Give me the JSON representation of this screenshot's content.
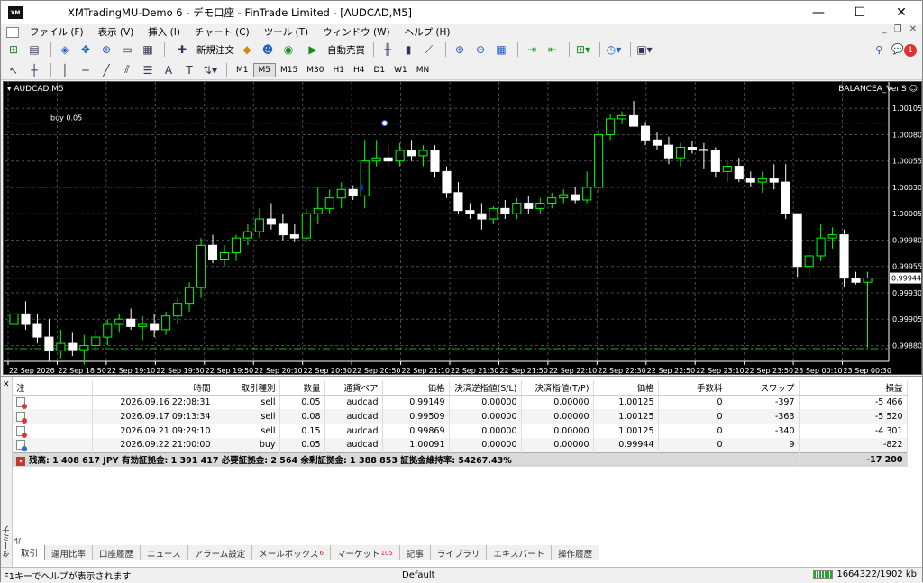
{
  "window": {
    "title": "XMTradingMU-Demo 6 - デモ口座 - FinTrade Limited - [AUDCAD,M5]",
    "app_logo": "XM"
  },
  "menu": [
    "ファイル (F)",
    "表示 (V)",
    "挿入 (I)",
    "チャート (C)",
    "ツール (T)",
    "ウィンドウ (W)",
    "ヘルプ (H)"
  ],
  "toolbar": {
    "new_order": "新規注文",
    "auto_trading": "自動売買",
    "notification_count": "1",
    "timeframes": [
      "M1",
      "M5",
      "M15",
      "M30",
      "H1",
      "H4",
      "D1",
      "W1",
      "MN"
    ],
    "active_timeframe": "M5"
  },
  "chart": {
    "symbol_label": "AUDCAD,M5",
    "ea_label": "BALANCEA_Ver.S",
    "buy_label": "buy 0.05",
    "current_price": "0.99944",
    "colors": {
      "background": "#000000",
      "up": "#00ff00",
      "down": "#ffffff",
      "grid": "#4a4a4a",
      "trade_line": "#1a2cff"
    },
    "price_ticks": [
      "1.00105",
      "1.00080",
      "1.00055",
      "1.00030",
      "1.00005",
      "0.99980",
      "0.99955",
      "0.99930",
      "0.99905",
      "0.99880"
    ],
    "time_ticks": [
      "22 Sep 2026",
      "22 Sep 18:50",
      "22 Sep 19:10",
      "22 Sep 19:30",
      "22 Sep 19:50",
      "22 Sep 20:10",
      "22 Sep 20:30",
      "22 Sep 20:50",
      "22 Sep 21:10",
      "22 Sep 21:30",
      "22 Sep 21:50",
      "22 Sep 22:10",
      "22 Sep 22:30",
      "22 Sep 22:50",
      "22 Sep 23:10",
      "22 Sep 23:50",
      "23 Sep 00:10",
      "23 Sep 00:30"
    ]
  },
  "chart_data": {
    "type": "candlestick",
    "ylim": [
      0.99865,
      1.00118
    ],
    "levels": {
      "buy_entry": 1.00091,
      "current": 0.99944,
      "lower": 0.99877
    },
    "candles": [
      [
        0.999,
        0.99915,
        0.99885,
        0.9991
      ],
      [
        0.9991,
        0.99922,
        0.99895,
        0.999
      ],
      [
        0.999,
        0.9991,
        0.99882,
        0.99888
      ],
      [
        0.99888,
        0.99905,
        0.99865,
        0.99875
      ],
      [
        0.99875,
        0.99895,
        0.99868,
        0.99882
      ],
      [
        0.99882,
        0.99892,
        0.9987,
        0.99876
      ],
      [
        0.99876,
        0.9989,
        0.99862,
        0.9988
      ],
      [
        0.9988,
        0.99895,
        0.99875,
        0.99888
      ],
      [
        0.99888,
        0.99905,
        0.9988,
        0.999
      ],
      [
        0.999,
        0.9991,
        0.99892,
        0.99905
      ],
      [
        0.99905,
        0.99915,
        0.99895,
        0.99898
      ],
      [
        0.99898,
        0.99908,
        0.99885,
        0.999
      ],
      [
        0.999,
        0.9991,
        0.99888,
        0.99895
      ],
      [
        0.99895,
        0.99912,
        0.9989,
        0.99908
      ],
      [
        0.99908,
        0.99925,
        0.999,
        0.9992
      ],
      [
        0.9992,
        0.9994,
        0.99912,
        0.99935
      ],
      [
        0.99935,
        0.99982,
        0.99925,
        0.99975
      ],
      [
        0.99975,
        0.99985,
        0.99958,
        0.99962
      ],
      [
        0.99962,
        0.99975,
        0.99955,
        0.99968
      ],
      [
        0.99968,
        0.99985,
        0.9996,
        0.99982
      ],
      [
        0.99982,
        0.99995,
        0.99975,
        0.99988
      ],
      [
        0.99988,
        1.0001,
        0.99982,
        1.0
      ],
      [
        1.0,
        1.00015,
        0.9999,
        0.99995
      ],
      [
        0.99995,
        1.00005,
        0.9998,
        0.99985
      ],
      [
        0.99985,
        0.99995,
        0.99978,
        0.99982
      ],
      [
        0.99982,
        1.0001,
        0.99978,
        1.00005
      ],
      [
        1.00005,
        1.0003,
        0.99995,
        1.0001
      ],
      [
        1.0001,
        1.00028,
        1.00005,
        1.0002
      ],
      [
        1.0002,
        1.00035,
        1.0001,
        1.00028
      ],
      [
        1.00028,
        1.00032,
        1.00018,
        1.00022
      ],
      [
        1.00022,
        1.00075,
        1.0001,
        1.00055
      ],
      [
        1.00055,
        1.00075,
        1.0005,
        1.00058
      ],
      [
        1.00058,
        1.0007,
        1.0005,
        1.00055
      ],
      [
        1.00055,
        1.00072,
        1.0005,
        1.00065
      ],
      [
        1.00065,
        1.00075,
        1.00055,
        1.0006
      ],
      [
        1.0006,
        1.0007,
        1.0005,
        1.00065
      ],
      [
        1.00065,
        1.0007,
        1.0004,
        1.00045
      ],
      [
        1.00045,
        1.0005,
        1.0002,
        1.00025
      ],
      [
        1.00025,
        1.00035,
        1.00005,
        1.00008
      ],
      [
        1.00008,
        1.00015,
        1.0,
        1.00005
      ],
      [
        1.00005,
        1.00015,
        0.9999,
        1.0
      ],
      [
        1.0,
        1.00012,
        0.99995,
        1.0001
      ],
      [
        1.0001,
        1.00018,
        1.0,
        1.00005
      ],
      [
        1.00005,
        1.0002,
        1.0,
        1.00015
      ],
      [
        1.00015,
        1.00022,
        1.00005,
        1.0001
      ],
      [
        1.0001,
        1.0002,
        1.00005,
        1.00015
      ],
      [
        1.00015,
        1.00025,
        1.0001,
        1.0002
      ],
      [
        1.0002,
        1.00028,
        1.00015,
        1.00023
      ],
      [
        1.00023,
        1.0003,
        1.00015,
        1.00018
      ],
      [
        1.00018,
        1.00045,
        1.00015,
        1.0003
      ],
      [
        1.0003,
        1.00085,
        1.00025,
        1.0008
      ],
      [
        1.0008,
        1.001,
        1.00075,
        1.00095
      ],
      [
        1.00095,
        1.00102,
        1.0009,
        1.00098
      ],
      [
        1.00098,
        1.00112,
        1.0009,
        1.00088
      ],
      [
        1.00088,
        1.00092,
        1.0007,
        1.00075
      ],
      [
        1.00075,
        1.00082,
        1.00065,
        1.0007
      ],
      [
        1.0007,
        1.00078,
        1.00052,
        1.00058
      ],
      [
        1.00058,
        1.00072,
        1.0005,
        1.00068
      ],
      [
        1.00068,
        1.00074,
        1.00062,
        1.00066
      ],
      [
        1.00066,
        1.00072,
        1.00048,
        1.00065
      ],
      [
        1.00065,
        1.00068,
        1.0004,
        1.00045
      ],
      [
        1.00045,
        1.00055,
        1.00035,
        1.0005
      ],
      [
        1.0005,
        1.00058,
        1.00035,
        1.00038
      ],
      [
        1.00038,
        1.00045,
        1.0003,
        1.00035
      ],
      [
        1.00035,
        1.00045,
        1.00025,
        1.00038
      ],
      [
        1.00038,
        1.00052,
        1.00028,
        1.00035
      ],
      [
        1.00035,
        1.00052,
        1.0,
        1.00005
      ],
      [
        1.00005,
        1.00005,
        0.99945,
        0.99955
      ],
      [
        0.99955,
        0.99975,
        0.99945,
        0.99965
      ],
      [
        0.99965,
        0.99995,
        0.9996,
        0.99982
      ],
      [
        0.99982,
        0.99992,
        0.99972,
        0.99985
      ],
      [
        0.99985,
        0.9999,
        0.99935,
        0.99944
      ],
      [
        0.99944,
        0.9995,
        0.99938,
        0.9994
      ],
      [
        0.9994,
        0.9995,
        0.99878,
        0.99944
      ]
    ]
  },
  "trades": {
    "columns": [
      "注",
      "時間",
      "取引種別",
      "数量",
      "通貨ペア",
      "価格",
      "決済逆指値(S/L)",
      "決済指値(T/P)",
      "価格",
      "手数料",
      "スワップ",
      "損益"
    ],
    "rows": [
      {
        "type": "sell",
        "cells": [
          "",
          "2026.09.16 22:08:31",
          "sell",
          "0.05",
          "audcad",
          "0.99149",
          "0.00000",
          "0.00000",
          "1.00125",
          "0",
          "-397",
          "-5 466"
        ]
      },
      {
        "type": "sell",
        "cells": [
          "",
          "2026.09.17 09:13:34",
          "sell",
          "0.08",
          "audcad",
          "0.99509",
          "0.00000",
          "0.00000",
          "1.00125",
          "0",
          "-363",
          "-5 520"
        ]
      },
      {
        "type": "sell",
        "cells": [
          "",
          "2026.09.21 09:29:10",
          "sell",
          "0.15",
          "audcad",
          "0.99869",
          "0.00000",
          "0.00000",
          "1.00125",
          "0",
          "-340",
          "-4 301"
        ]
      },
      {
        "type": "buy",
        "cells": [
          "",
          "2026.09.22 21:00:00",
          "buy",
          "0.05",
          "audcad",
          "1.00091",
          "0.00000",
          "0.00000",
          "0.99944",
          "0",
          "9",
          "-822"
        ]
      }
    ],
    "summary": "残高: 1 408 617 JPY  有効証拠金: 1 391 417  必要証拠金: 2 564  余剰証拠金: 1 388 853  証拠金維持率: 54267.43%",
    "summary_total": "-17 200"
  },
  "terminal_label": "ターミナル",
  "tabs": [
    {
      "label": "取引",
      "count": ""
    },
    {
      "label": "運用比率",
      "count": ""
    },
    {
      "label": "口座履歴",
      "count": ""
    },
    {
      "label": "ニュース",
      "count": ""
    },
    {
      "label": "アラーム設定",
      "count": ""
    },
    {
      "label": "メールボックス",
      "count": "6"
    },
    {
      "label": "マーケット",
      "count": "105"
    },
    {
      "label": "記事",
      "count": ""
    },
    {
      "label": "ライブラリ",
      "count": ""
    },
    {
      "label": "エキスパート",
      "count": ""
    },
    {
      "label": "操作履歴",
      "count": ""
    }
  ],
  "status": {
    "help": "F1キーでヘルプが表示されます",
    "profile": "Default",
    "traffic": "1664322/1902 kb"
  }
}
